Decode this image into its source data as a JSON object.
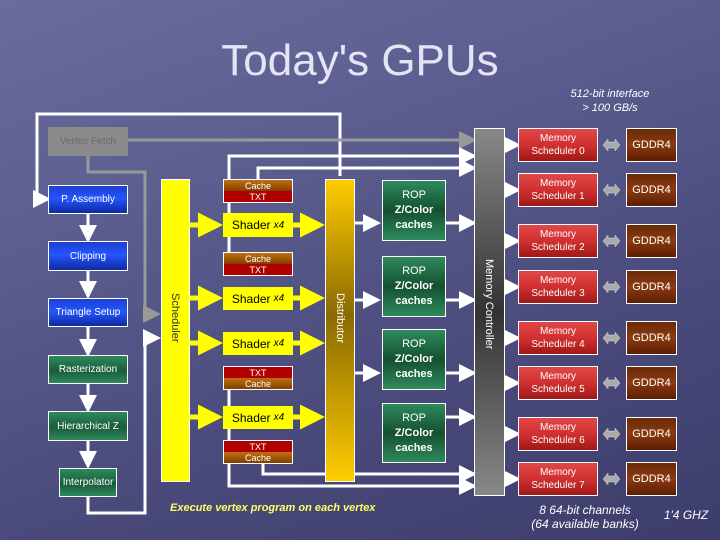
{
  "title": "Today's GPUs",
  "interface_note": {
    "line1": "512-bit interface",
    "line2": "> 100 GB/s"
  },
  "pipeline": {
    "vertex_fetch": "Vertex Fetch",
    "stages": [
      "P. Assembly",
      "Clipping",
      "Triangle Setup",
      "Rasterization",
      "Hierarchical Z",
      "Interpolator"
    ]
  },
  "scheduler": "Scheduler",
  "distributor": "Distributor",
  "shader": {
    "label": "Shader",
    "multiplier": "x4"
  },
  "cache_label": "Cache",
  "txt_label": "TXT",
  "rop": {
    "line1": "ROP",
    "line2": "Z/Color",
    "line3": "caches"
  },
  "memory_controller": "Memory Controller",
  "memory_schedulers": [
    {
      "line1": "Memory",
      "line2": "Scheduler 0"
    },
    {
      "line1": "Memory",
      "line2": "Scheduler 1"
    },
    {
      "line1": "Memory",
      "line2": "Scheduler 2"
    },
    {
      "line1": "Memory",
      "line2": "Scheduler 3"
    },
    {
      "line1": "Memory",
      "line2": "Scheduler 4"
    },
    {
      "line1": "Memory",
      "line2": "Scheduler 5"
    },
    {
      "line1": "Memory",
      "line2": "Scheduler 6"
    },
    {
      "line1": "Memory",
      "line2": "Scheduler 7"
    }
  ],
  "gddr_label": "GDDR4",
  "vertex_note": "Execute vertex program on each vertex",
  "channels_note": {
    "line1": "8 64-bit channels",
    "line2": "(64 available banks)"
  },
  "clock_note": "1'4 GHZ",
  "colors": {
    "yellow": "#ffff00",
    "blue": "#2455ff",
    "green": "#1a5c3a",
    "red": "#d03030",
    "brown": "#6a2a08"
  }
}
